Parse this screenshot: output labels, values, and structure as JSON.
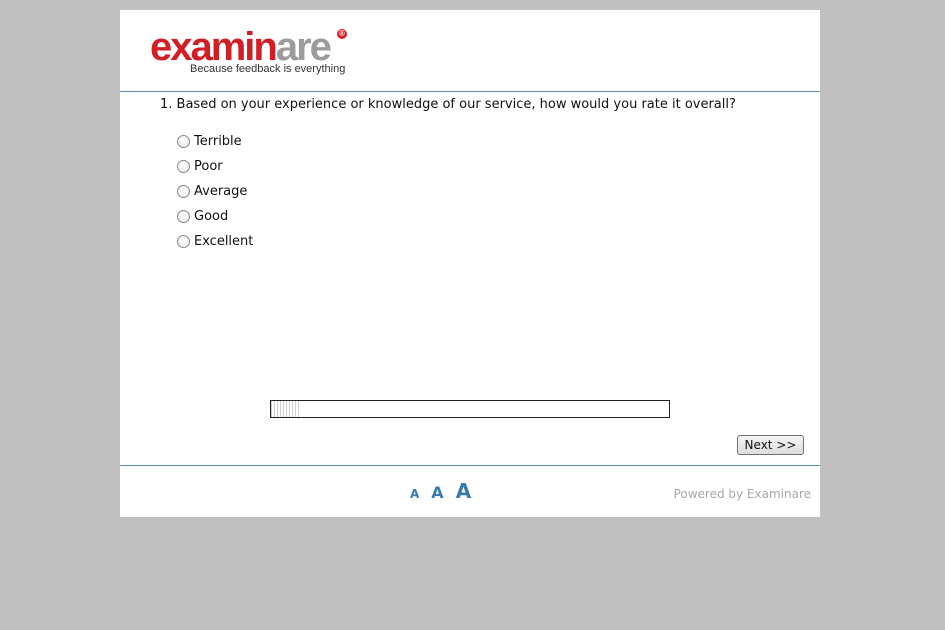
{
  "brand": {
    "logo_part1": "exami",
    "logo_part2": "n",
    "logo_part3": "are",
    "registered_mark": "®",
    "tagline": "Because feedback is everything",
    "primary_color": "#d21f26",
    "secondary_color": "#9c9c9c"
  },
  "survey": {
    "question": "1. Based on your experience or knowledge of our service, how would you rate it overall?",
    "options": [
      {
        "label": "Terrible",
        "selected": false
      },
      {
        "label": "Poor",
        "selected": false
      },
      {
        "label": "Average",
        "selected": false
      },
      {
        "label": "Good",
        "selected": false
      },
      {
        "label": "Excellent",
        "selected": false
      }
    ],
    "progress_fraction": 0.07,
    "next_label": "Next >>"
  },
  "footer": {
    "font_size_small": "A",
    "font_size_medium": "A",
    "font_size_large": "A",
    "powered_by": "Powered by Examinare",
    "accent_color": "#3b7ab0"
  }
}
